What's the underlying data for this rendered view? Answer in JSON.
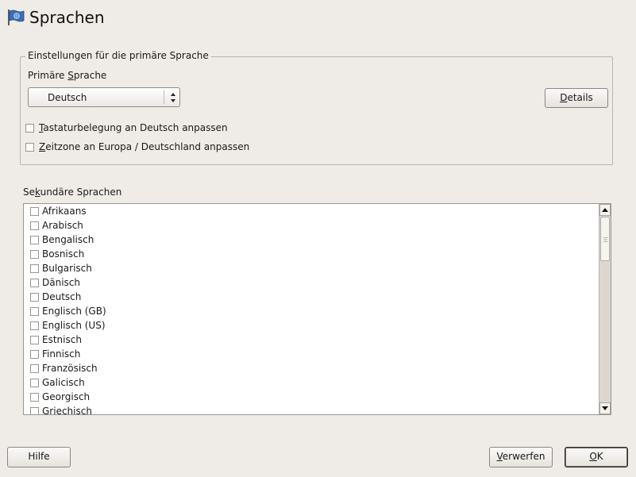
{
  "header": {
    "title": "Sprachen",
    "icon": "language-flag-icon"
  },
  "primary": {
    "group_title": "Einstellungen für die primäre Sprache",
    "label_pre": "Primäre ",
    "label_mn": "S",
    "label_post": "prache",
    "selected_language": "Deutsch",
    "details_mn": "D",
    "details_rest": "etails",
    "keyboard_mn": "T",
    "keyboard_rest": "astaturbelegung an Deutsch anpassen",
    "timezone_mn": "Z",
    "timezone_rest": "eitzone an Europa / Deutschland anpassen",
    "keyboard_checked": false,
    "timezone_checked": false
  },
  "secondary": {
    "label_pre": "Se",
    "label_mn": "k",
    "label_post": "undäre Sprachen",
    "languages": [
      "Afrikaans",
      "Arabisch",
      "Bengalisch",
      "Bosnisch",
      "Bulgarisch",
      "Dänisch",
      "Deutsch",
      "Englisch (GB)",
      "Englisch (US)",
      "Estnisch",
      "Finnisch",
      "Französisch",
      "Galicisch",
      "Georgisch",
      "Griechisch"
    ]
  },
  "footer": {
    "help_label": "Hilfe",
    "discard_mn": "V",
    "discard_rest": "erwerfen",
    "ok_mn": "O",
    "ok_rest": "K"
  },
  "colors": {
    "background": "#efebe7",
    "flag_blue": "#3a6fb5"
  }
}
